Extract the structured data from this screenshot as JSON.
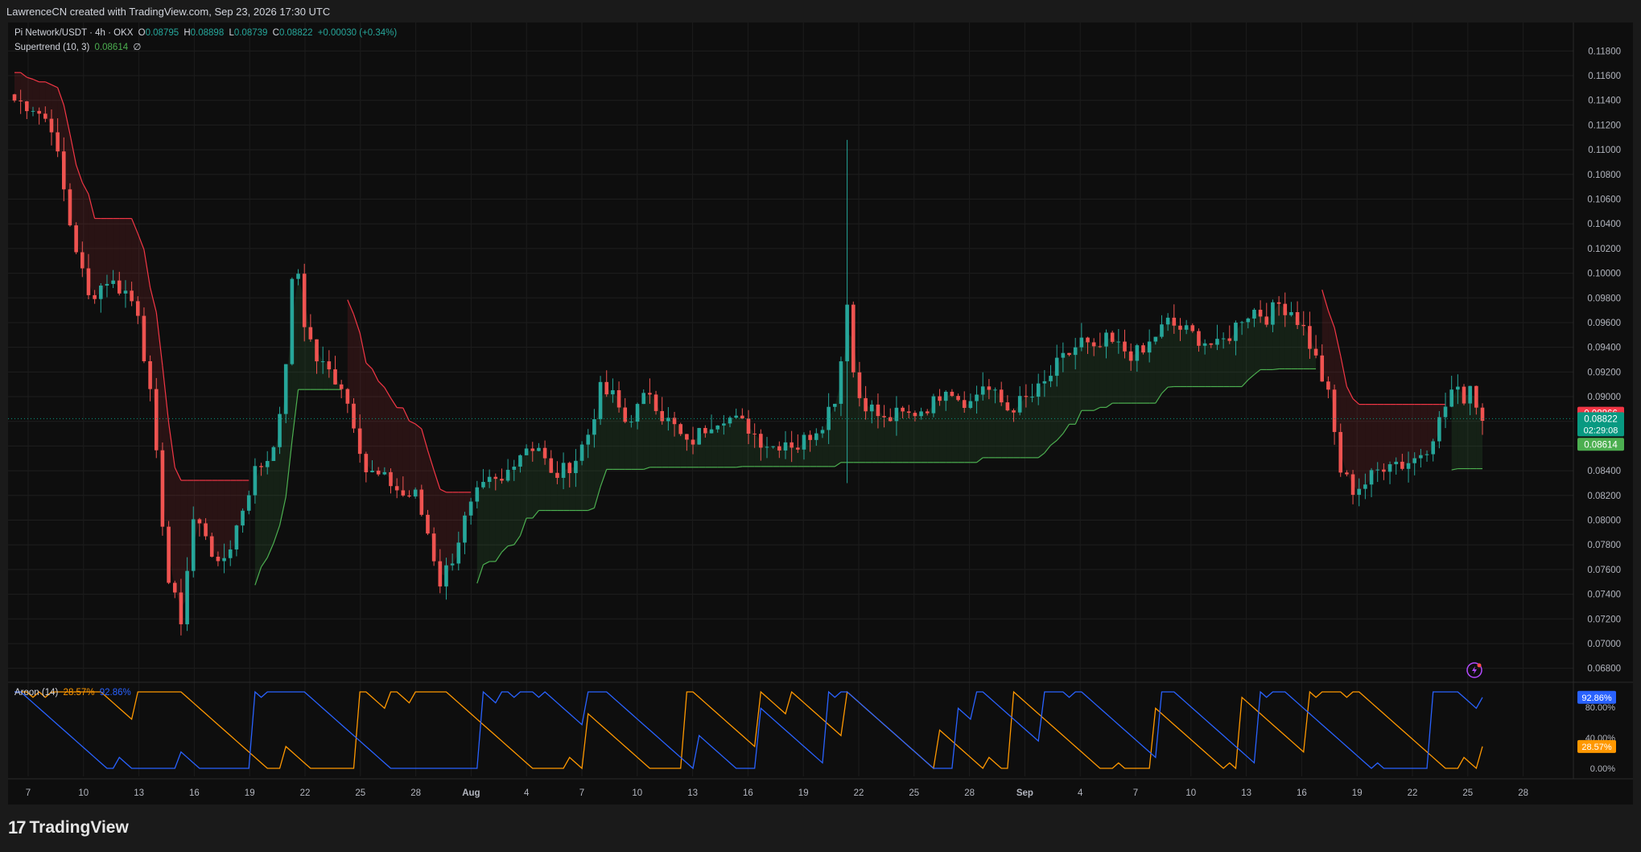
{
  "header": {
    "credit": "LawrenceCN created with TradingView.com, Sep 23, 2026 17:30 UTC"
  },
  "legend": {
    "symbol": "Pi Network/USDT · 4h · OKX",
    "o_label": "O",
    "o": "0.08795",
    "h_label": "H",
    "h": "0.08898",
    "l_label": "L",
    "l": "0.08739",
    "c_label": "C",
    "c": "0.08822",
    "change": "+0.00030 (+0.34%)",
    "supertrend_name": "Supertrend (10, 3)",
    "supertrend_value": "0.08614",
    "supertrend_extra": "∅",
    "aroon_name": "Aroon (14)",
    "aroon_down": "28.57%",
    "aroon_up": "92.86%"
  },
  "branding": {
    "logo_text": "TradingView"
  },
  "colors": {
    "background": "#0e0e0e",
    "up": "#26a69a",
    "down": "#ef5350",
    "supertrend_up": "#4caf50",
    "supertrend_down": "#f23645",
    "aroon_up": "#2962ff",
    "aroon_down": "#ff9800"
  },
  "chart_data": [
    {
      "type": "candlestick",
      "title": "Pi Network/USDT · 4h · OKX",
      "ylim": [
        0.067,
        0.119
      ],
      "y_ticks": [
        "0.11800",
        "0.11600",
        "0.11400",
        "0.11200",
        "0.11000",
        "0.10800",
        "0.10600",
        "0.10400",
        "0.10200",
        "0.10000",
        "0.09800",
        "0.09600",
        "0.09400",
        "0.09200",
        "0.09000",
        "0.08800",
        "0.08600",
        "0.08400",
        "0.08200",
        "0.08000",
        "0.07800",
        "0.07600",
        "0.07400",
        "0.07200",
        "0.07000",
        "0.06800"
      ],
      "x_ticks": [
        "7",
        "10",
        "13",
        "16",
        "19",
        "22",
        "25",
        "28",
        "Aug",
        "4",
        "7",
        "10",
        "13",
        "16",
        "19",
        "22",
        "25",
        "28",
        "Sep",
        "4",
        "7",
        "10",
        "13",
        "16",
        "19",
        "22",
        "25",
        "28"
      ],
      "price_labels": [
        {
          "value": 0.08866,
          "text": "0.08866",
          "color": "#f23645"
        },
        {
          "value": 0.08822,
          "text": "0.08822",
          "sub": "02:29:08",
          "color": "#089981"
        },
        {
          "value": 0.08614,
          "text": "0.08614",
          "color": "#4caf50"
        }
      ],
      "close_anchors": [
        [
          0,
          0.114
        ],
        [
          3,
          0.1135
        ],
        [
          6,
          0.112
        ],
        [
          9,
          0.104
        ],
        [
          12,
          0.098
        ],
        [
          15,
          0.0995
        ],
        [
          18,
          0.0985
        ],
        [
          20,
          0.097
        ],
        [
          22,
          0.09
        ],
        [
          25,
          0.075
        ],
        [
          27,
          0.072
        ],
        [
          29,
          0.08
        ],
        [
          31,
          0.079
        ],
        [
          33,
          0.076
        ],
        [
          35,
          0.078
        ],
        [
          37,
          0.081
        ],
        [
          39,
          0.084
        ],
        [
          41,
          0.085
        ],
        [
          43,
          0.088
        ],
        [
          44,
          0.093
        ],
        [
          45,
          0.099
        ],
        [
          46,
          0.1
        ],
        [
          47,
          0.096
        ],
        [
          49,
          0.093
        ],
        [
          51,
          0.092
        ],
        [
          53,
          0.091
        ],
        [
          55,
          0.088
        ],
        [
          57,
          0.084
        ],
        [
          59,
          0.0835
        ],
        [
          61,
          0.083
        ],
        [
          63,
          0.082
        ],
        [
          65,
          0.082
        ],
        [
          67,
          0.079
        ],
        [
          69,
          0.075
        ],
        [
          71,
          0.077
        ],
        [
          73,
          0.08
        ],
        [
          75,
          0.082
        ],
        [
          77,
          0.083
        ],
        [
          79,
          0.083
        ],
        [
          81,
          0.085
        ],
        [
          83,
          0.086
        ],
        [
          85,
          0.086
        ],
        [
          87,
          0.0835
        ],
        [
          89,
          0.084
        ],
        [
          91,
          0.085
        ],
        [
          93,
          0.087
        ],
        [
          95,
          0.0905
        ],
        [
          97,
          0.09
        ],
        [
          99,
          0.088
        ],
        [
          101,
          0.089
        ],
        [
          103,
          0.0905
        ],
        [
          105,
          0.0885
        ],
        [
          107,
          0.0875
        ],
        [
          109,
          0.086
        ],
        [
          111,
          0.087
        ],
        [
          113,
          0.088
        ],
        [
          115,
          0.0885
        ],
        [
          117,
          0.088
        ],
        [
          119,
          0.0875
        ],
        [
          121,
          0.0865
        ],
        [
          123,
          0.086
        ],
        [
          125,
          0.0865
        ],
        [
          127,
          0.086
        ],
        [
          129,
          0.087
        ],
        [
          131,
          0.088
        ],
        [
          133,
          0.09
        ],
        [
          134,
          0.093
        ],
        [
          135,
          0.098
        ],
        [
          136,
          0.092
        ],
        [
          137,
          0.09
        ],
        [
          139,
          0.089
        ],
        [
          141,
          0.088
        ],
        [
          143,
          0.0885
        ],
        [
          145,
          0.0885
        ],
        [
          147,
          0.089
        ],
        [
          149,
          0.0895
        ],
        [
          151,
          0.091
        ],
        [
          153,
          0.09
        ],
        [
          155,
          0.0895
        ],
        [
          157,
          0.091
        ],
        [
          159,
          0.09
        ],
        [
          161,
          0.089
        ],
        [
          163,
          0.0895
        ],
        [
          165,
          0.09
        ],
        [
          167,
          0.091
        ],
        [
          169,
          0.0925
        ],
        [
          171,
          0.0935
        ],
        [
          173,
          0.0945
        ],
        [
          175,
          0.0935
        ],
        [
          177,
          0.0945
        ],
        [
          179,
          0.094
        ],
        [
          181,
          0.0935
        ],
        [
          183,
          0.0935
        ],
        [
          185,
          0.095
        ],
        [
          187,
          0.096
        ],
        [
          189,
          0.0955
        ],
        [
          191,
          0.095
        ],
        [
          193,
          0.0945
        ],
        [
          195,
          0.094
        ],
        [
          197,
          0.095
        ],
        [
          199,
          0.0965
        ],
        [
          201,
          0.097
        ],
        [
          203,
          0.0965
        ],
        [
          205,
          0.0975
        ],
        [
          207,
          0.097
        ],
        [
          209,
          0.0955
        ],
        [
          211,
          0.093
        ],
        [
          213,
          0.09
        ],
        [
          215,
          0.084
        ],
        [
          217,
          0.0825
        ],
        [
          219,
          0.083
        ],
        [
          221,
          0.084
        ],
        [
          223,
          0.085
        ],
        [
          225,
          0.0845
        ],
        [
          227,
          0.085
        ],
        [
          229,
          0.086
        ],
        [
          231,
          0.088
        ],
        [
          233,
          0.0905
        ],
        [
          235,
          0.09
        ],
        [
          236,
          0.091
        ],
        [
          237,
          0.0895
        ],
        [
          238,
          0.0882
        ]
      ]
    },
    {
      "type": "line",
      "title": "Aroon (14)",
      "ylim": [
        0,
        100
      ],
      "y_ticks": [
        "80.00%",
        "40.00%",
        "0.00%"
      ],
      "series": [
        {
          "name": "Aroon Up",
          "color": "#2962ff",
          "last": 92.86
        },
        {
          "name": "Aroon Down",
          "color": "#ff9800",
          "last": 28.57
        }
      ]
    }
  ]
}
